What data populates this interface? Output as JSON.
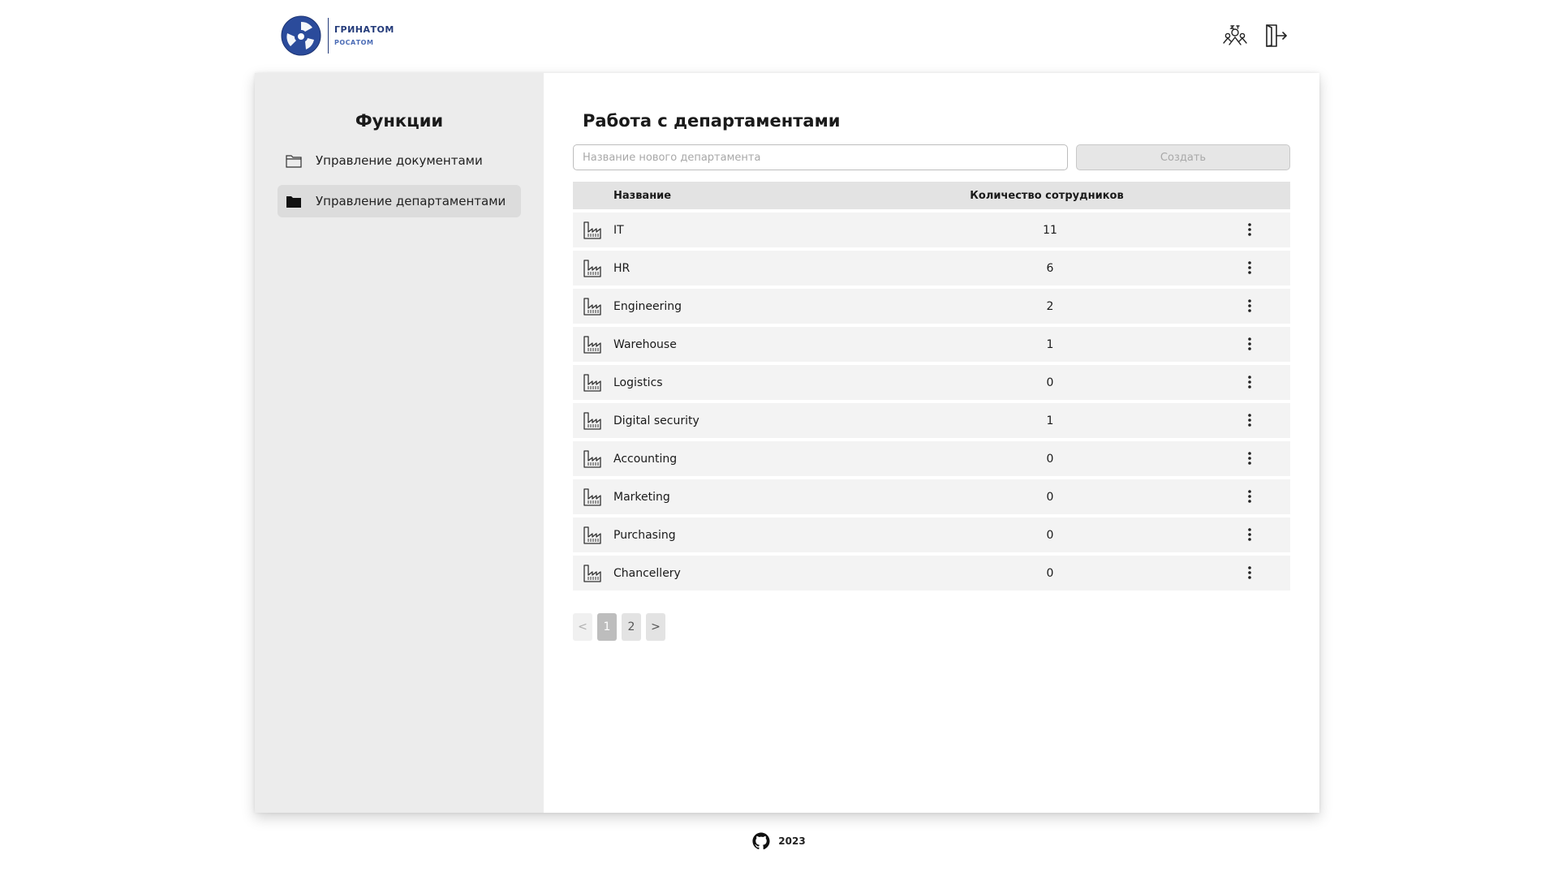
{
  "brand": {
    "name": "ГРИНАТОМ",
    "sub": "РОСАТОМ",
    "color": "#243b7a"
  },
  "header": {
    "icons": [
      "users-icon",
      "logout-icon"
    ]
  },
  "sidebar": {
    "title": "Функции",
    "items": [
      {
        "label": "Управление документами",
        "icon": "folder-outline-icon",
        "active": false
      },
      {
        "label": "Управление департаментами",
        "icon": "folder-filled-icon",
        "active": true
      }
    ]
  },
  "main": {
    "title": "Работа с департаментами",
    "input_placeholder": "Название нового департамента",
    "create_label": "Создать",
    "table": {
      "columns": [
        "Название",
        "Количество сотрудников"
      ],
      "rows": [
        {
          "name": "IT",
          "count": "11"
        },
        {
          "name": "HR",
          "count": "6"
        },
        {
          "name": "Engineering",
          "count": "2"
        },
        {
          "name": "Warehouse",
          "count": "1"
        },
        {
          "name": "Logistics",
          "count": "0"
        },
        {
          "name": "Digital security",
          "count": "1"
        },
        {
          "name": "Accounting",
          "count": "0"
        },
        {
          "name": "Marketing",
          "count": "0"
        },
        {
          "name": "Purchasing",
          "count": "0"
        },
        {
          "name": "Chancellery",
          "count": "0"
        }
      ]
    },
    "pagination": {
      "prev": "<",
      "pages": [
        "1",
        "2"
      ],
      "current": "1",
      "next": ">"
    }
  },
  "footer": {
    "year": "2023",
    "icon": "github-icon"
  }
}
